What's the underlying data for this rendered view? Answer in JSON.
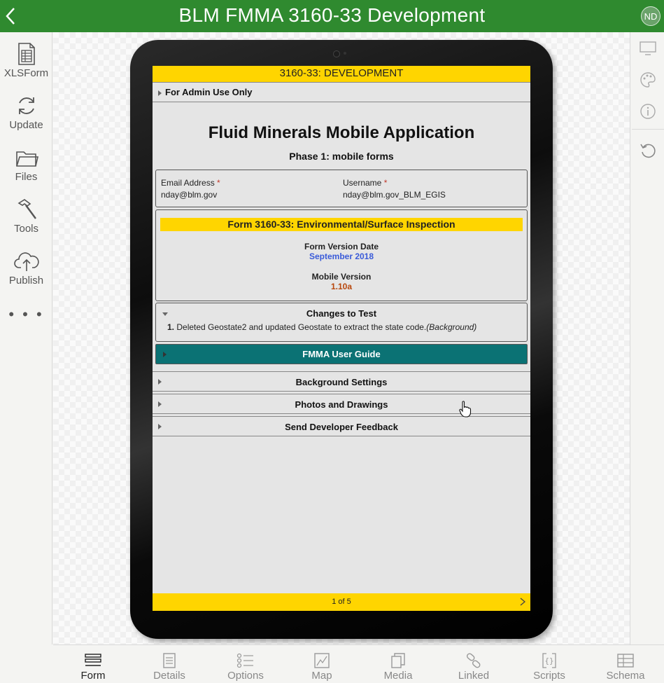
{
  "app": {
    "title": "BLM FMMA 3160-33 Development",
    "avatar_initials": "ND",
    "brand_color": "#2f8a2f"
  },
  "left_nav": [
    {
      "label": "XLSForm",
      "icon": "spreadsheet-icon"
    },
    {
      "label": "Update",
      "icon": "refresh-icon"
    },
    {
      "label": "Files",
      "icon": "folder-icon"
    },
    {
      "label": "Tools",
      "icon": "hammer-icon"
    },
    {
      "label": "Publish",
      "icon": "cloud-upload-icon"
    }
  ],
  "left_more": "• • •",
  "right_tools": [
    "monitor-icon",
    "palette-icon",
    "info-icon",
    "reset-icon"
  ],
  "form": {
    "header": "3160-33: DEVELOPMENT",
    "admin_group": "For Admin Use Only",
    "app_title": "Fluid Minerals Mobile Application",
    "app_subtitle": "Phase 1: mobile forms",
    "email_label": "Email Address",
    "email_value": "nday@blm.gov",
    "username_label": "Username",
    "username_value": "nday@blm.gov_BLM_EGIS",
    "required_mark": "*",
    "form_title": "Form 3160-33: Environmental/Surface Inspection",
    "version_date_label": "Form Version Date",
    "version_date_value": "September 2018",
    "mobile_version_label": "Mobile Version",
    "mobile_version_value": "1.10a",
    "changes_title": "Changes to Test",
    "changes_item_num": "1.",
    "changes_item_text": "Deleted Geostate2 and updated Geostate to extract the state code.",
    "changes_item_italic": "(Background)",
    "user_guide": "FMMA User Guide",
    "sections": [
      "Background Settings",
      "Photos and Drawings",
      "Send Developer Feedback"
    ],
    "page_indicator": "1 of 5",
    "colors": {
      "header_yellow": "#ffd500",
      "guide_teal": "#0b7274",
      "version_date_blue": "#3a5bd9",
      "mobile_version_orange": "#b8470c"
    }
  },
  "bottom_tabs": [
    {
      "label": "Form",
      "icon": "form-icon",
      "active": true
    },
    {
      "label": "Details",
      "icon": "details-icon",
      "active": false
    },
    {
      "label": "Options",
      "icon": "options-icon",
      "active": false
    },
    {
      "label": "Map",
      "icon": "map-icon",
      "active": false
    },
    {
      "label": "Media",
      "icon": "media-icon",
      "active": false
    },
    {
      "label": "Linked",
      "icon": "link-icon",
      "active": false
    },
    {
      "label": "Scripts",
      "icon": "scripts-icon",
      "active": false
    },
    {
      "label": "Schema",
      "icon": "schema-icon",
      "active": false
    }
  ]
}
